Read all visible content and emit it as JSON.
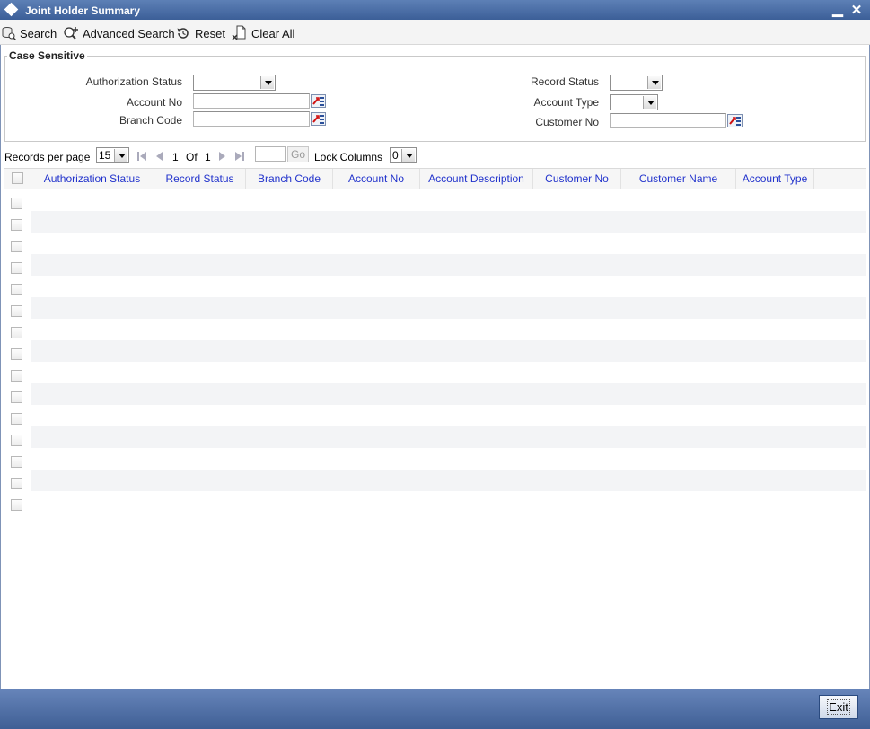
{
  "window": {
    "title": "Joint Holder Summary",
    "minimize": "▁",
    "close": "✕"
  },
  "toolbar": {
    "search": "Search",
    "advanced_search": "Advanced Search",
    "reset": "Reset",
    "clear_all": "Clear All"
  },
  "criteria": {
    "legend": "Case Sensitive",
    "authorization_status": {
      "label": "Authorization Status",
      "value": ""
    },
    "account_no": {
      "label": "Account No",
      "value": ""
    },
    "branch_code": {
      "label": "Branch Code",
      "value": ""
    },
    "record_status": {
      "label": "Record Status",
      "value": ""
    },
    "account_type": {
      "label": "Account Type",
      "value": ""
    },
    "customer_no": {
      "label": "Customer No",
      "value": ""
    }
  },
  "pager": {
    "records_per_page_label": "Records per page",
    "records_per_page": "15",
    "current_page": "1",
    "of_label": "Of",
    "total_pages": "1",
    "go_value": "",
    "go_label": "Go",
    "lock_columns_label": "Lock Columns",
    "lock_columns": "0"
  },
  "grid": {
    "columns": [
      "Authorization Status",
      "Record Status",
      "Branch Code",
      "Account No",
      "Account Description",
      "Customer No",
      "Customer Name",
      "Account Type"
    ],
    "rows": [
      {},
      {},
      {},
      {},
      {},
      {},
      {},
      {},
      {},
      {},
      {},
      {},
      {},
      {},
      {}
    ]
  },
  "footer": {
    "exit_label": "Exit"
  },
  "colors": {
    "title_bar": "#4a6ca6",
    "header_text": "#2233cc",
    "footer": "#5271a8"
  }
}
